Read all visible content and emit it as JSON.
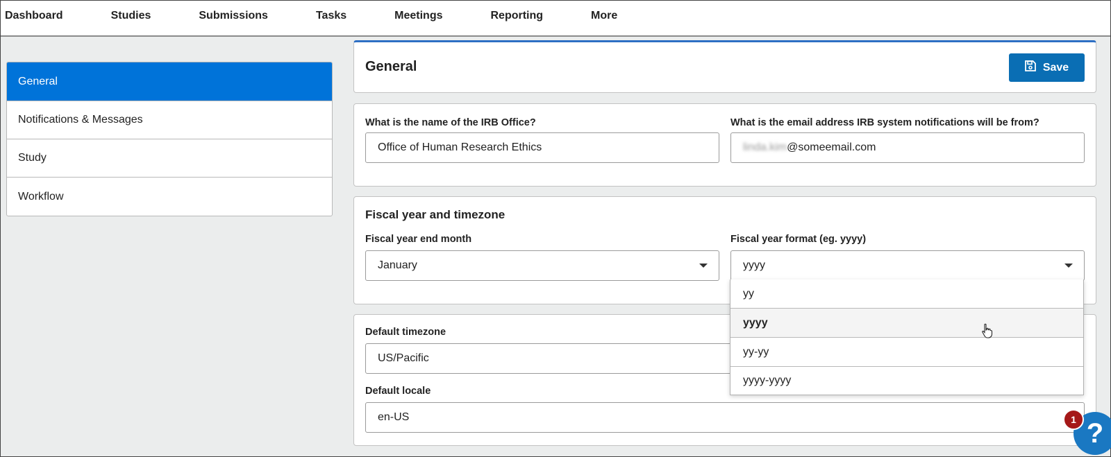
{
  "nav": {
    "items": [
      "Dashboard",
      "Studies",
      "Submissions",
      "Tasks",
      "Meetings",
      "Reporting",
      "More"
    ]
  },
  "sidebar": {
    "items": [
      {
        "label": "General",
        "active": true
      },
      {
        "label": "Notifications & Messages",
        "active": false
      },
      {
        "label": "Study",
        "active": false
      },
      {
        "label": "Workflow",
        "active": false
      }
    ]
  },
  "header": {
    "title": "General",
    "save_label": "Save",
    "accent": "#0a6eb4"
  },
  "irb": {
    "office_label": "What is the name of the IRB Office?",
    "office_value": "Office of Human Research Ethics",
    "email_label": "What is the email address IRB system notifications will be from?",
    "email_user_blurred": "linda.kim",
    "email_domain": "@someemail.com"
  },
  "fiscal": {
    "section_title": "Fiscal year and timezone",
    "end_month_label": "Fiscal year end month",
    "end_month_value": "January",
    "format_label": "Fiscal year format (eg. yyyy)",
    "format_value": "yyyy",
    "format_options": [
      "yy",
      "yyyy",
      "yy-yy",
      "yyyy-yyyy"
    ],
    "hovered_option": "yyyy"
  },
  "tz": {
    "timezone_label": "Default timezone",
    "timezone_value": "US/Pacific",
    "locale_label": "Default locale",
    "locale_value": "en-US"
  },
  "help": {
    "badge_count": "1",
    "glyph": "?"
  }
}
